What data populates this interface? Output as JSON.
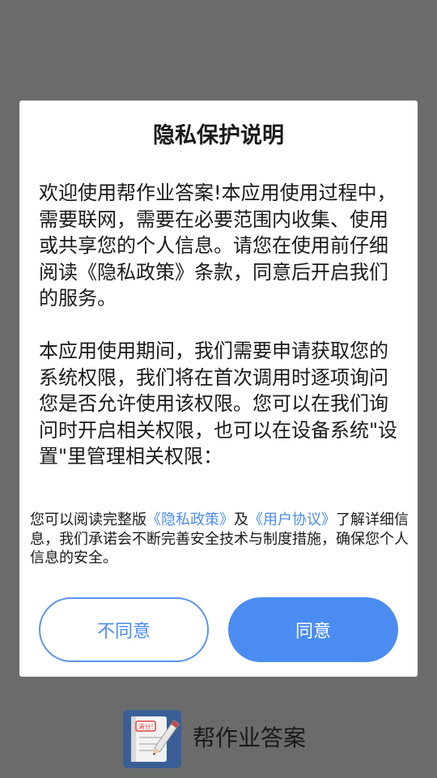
{
  "dialog": {
    "title": "隐私保护说明",
    "paragraph_1": "欢迎使用帮作业答案!本应用使用过程中，需要联网，需要在必要范围内收集、使用或共享您的个人信息。请您在使用前仔细阅读《隐私政策》条款，同意后开启我们的服务。",
    "paragraph_2": "本应用使用期间，我们需要申请获取您的系统权限，我们将在首次调用时逐项询问您是否允许使用该权限。您可以在我们询问时开启相关权限，也可以在设备系统\"设置\"里管理相关权限：",
    "footer": {
      "prefix": "您可以阅读完整版",
      "privacy_link": "《隐私政策》",
      "middle": "及",
      "agreement_link": "《用户协议》",
      "suffix": "了解详细信息，我们承诺会不断完善安全技术与制度措施，确保您个人信息的安全。"
    },
    "disagree_label": "不同意",
    "agree_label": "同意"
  },
  "brand": {
    "app_name": "帮作业答案",
    "icon": "notebook-pencil-icon",
    "icon_badge_text": "满分!"
  },
  "colors": {
    "accent": "#4a8cf0",
    "overlay": "#6b6b6b",
    "icon_background": "#3a5f96"
  }
}
